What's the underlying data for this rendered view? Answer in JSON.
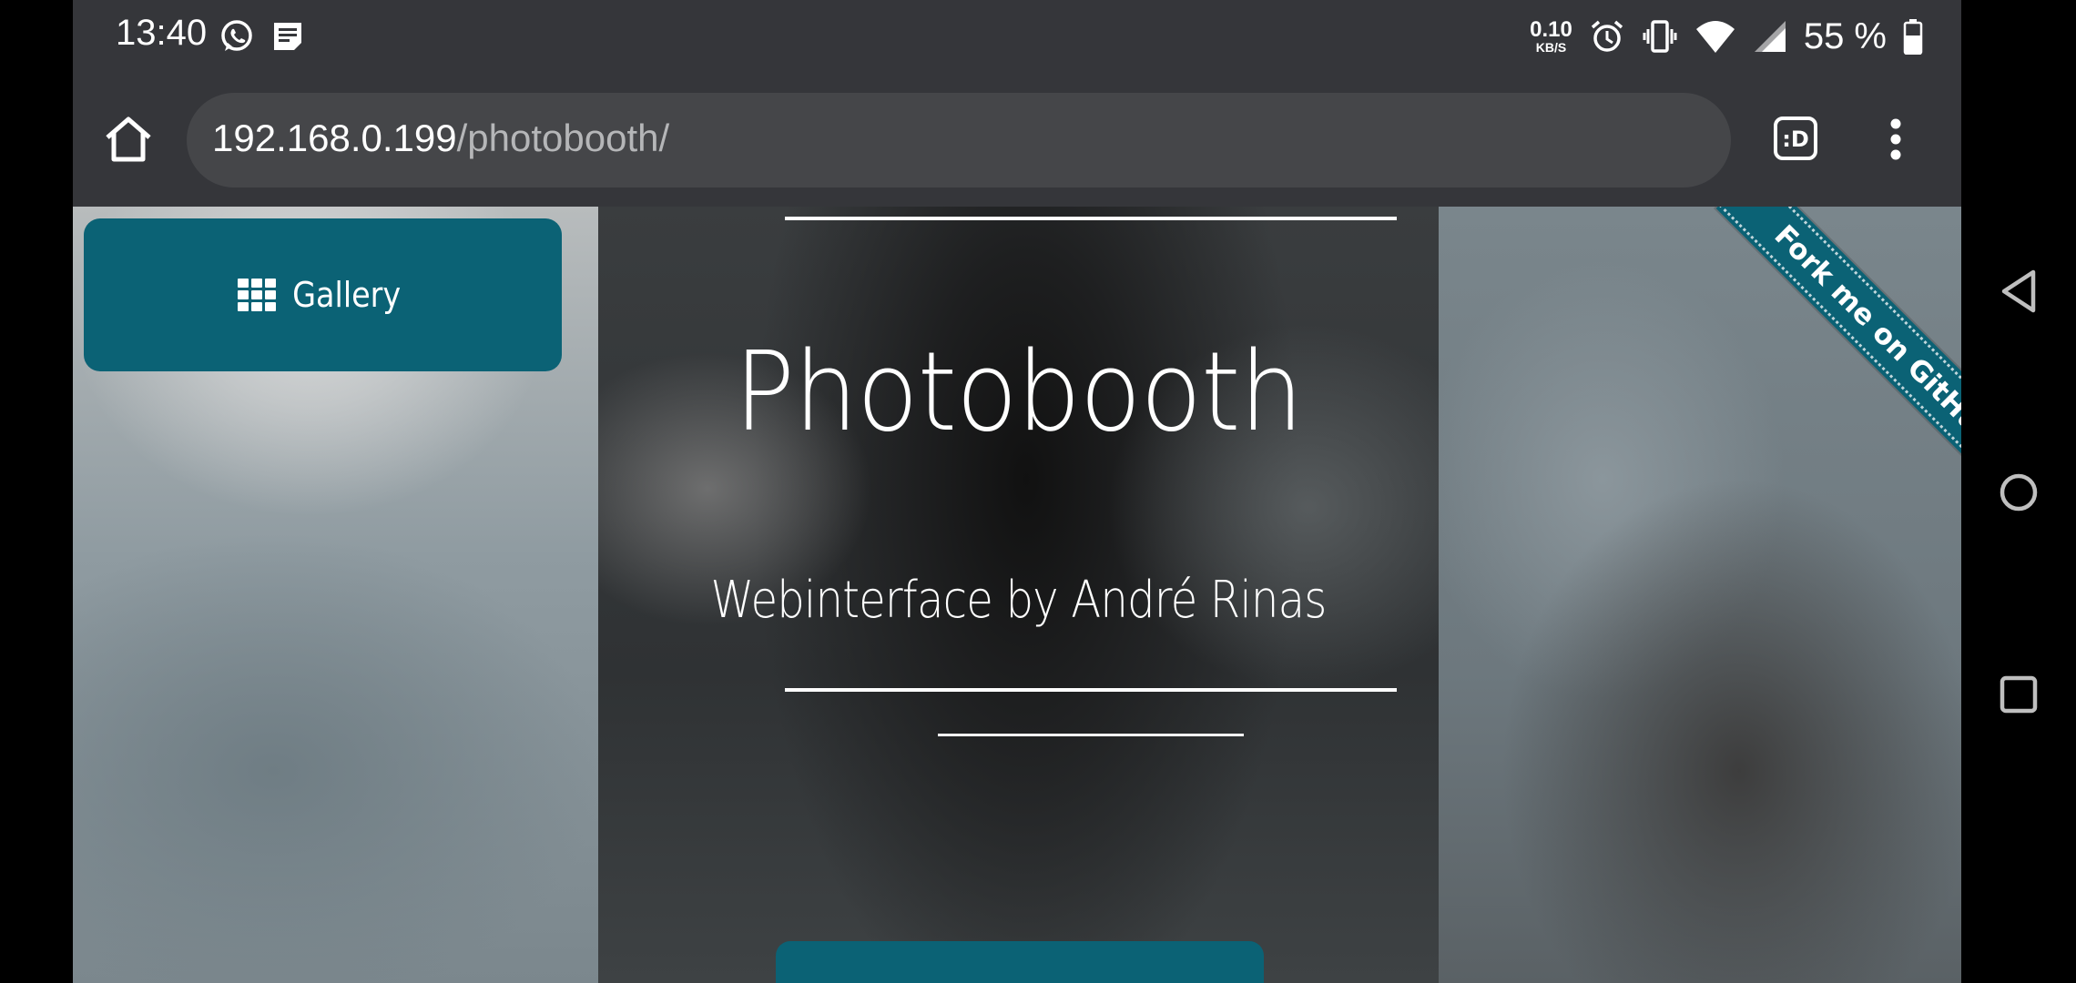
{
  "status_bar": {
    "time": "13:40",
    "left_icons": [
      "whatsapp-icon",
      "notes-icon"
    ],
    "net_speed_value": "0.10",
    "net_speed_unit": "KB/S",
    "right_icons": [
      "alarm-icon",
      "vibrate-icon",
      "wifi-icon",
      "signal-icon",
      "battery-icon"
    ],
    "battery": "55 %"
  },
  "browser": {
    "url_host": "192.168.0.199",
    "url_path": "/photobooth/",
    "home_icon": "home-icon",
    "extension_label": ":D",
    "menu_icon": "more-vert-icon"
  },
  "page": {
    "gallery_button_label": "Gallery",
    "title": "Photobooth",
    "subtitle": "Webinterface by André Rinas",
    "ribbon_text": "Fork me on GitHub",
    "accent_color": "#0b6275"
  },
  "nav_bar": {
    "buttons": [
      "back-icon",
      "home-circle-icon",
      "recents-icon"
    ]
  }
}
